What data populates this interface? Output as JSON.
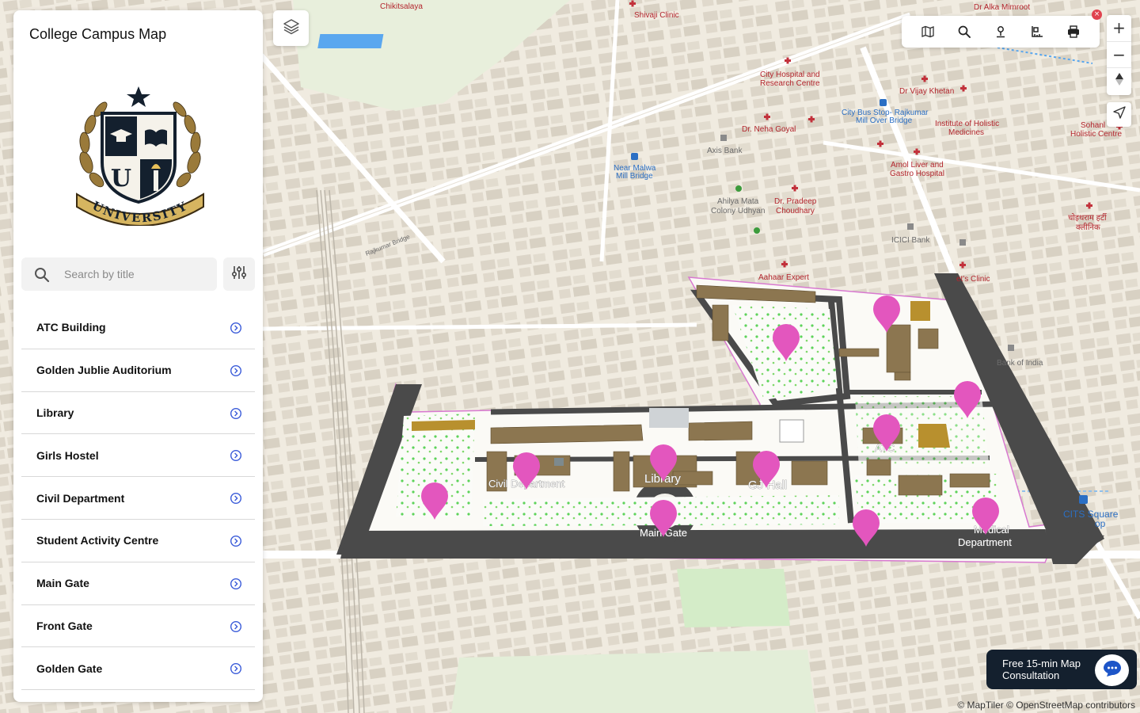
{
  "app": {
    "title": "College Campus Map"
  },
  "logo": {
    "letter": "U",
    "ribbon_text": "UNIVERSITY"
  },
  "search": {
    "placeholder": "Search by title",
    "value": ""
  },
  "locations": [
    {
      "label": "ATC Building"
    },
    {
      "label": "Golden Jublie Auditorium"
    },
    {
      "label": "Library"
    },
    {
      "label": "Girls Hostel"
    },
    {
      "label": "Civil Department"
    },
    {
      "label": "Student Activity Centre"
    },
    {
      "label": "Main Gate"
    },
    {
      "label": "Front Gate"
    },
    {
      "label": "Golden Gate"
    }
  ],
  "toolbar": {
    "icons": [
      "map-view-icon",
      "search-icon",
      "pin-icon",
      "ruler-icon",
      "print-icon"
    ]
  },
  "map_controls": {
    "zoom_in": "+",
    "zoom_out": "−",
    "close_badge": "×"
  },
  "map": {
    "places": [
      {
        "name": "Chikitsalaya"
      },
      {
        "name": "Shivaji Clinic"
      },
      {
        "name": "Dr Alka Mimroot"
      },
      {
        "name": "City Hospital and"
      },
      {
        "name": "Research Centre"
      },
      {
        "name": "Dr Vijay Khetan"
      },
      {
        "name": "City Bus Stop- Rajkumar"
      },
      {
        "name": "Mill Over Bridge"
      },
      {
        "name": "Institute of Holistic"
      },
      {
        "name": "Medicines"
      },
      {
        "name": "Sohanl"
      },
      {
        "name": "Holistic Centre"
      },
      {
        "name": "Dr. Neha Goyal"
      },
      {
        "name": "Axis Bank"
      },
      {
        "name": "Near Malwa"
      },
      {
        "name": "Mill Bridge"
      },
      {
        "name": "Amol Liver and"
      },
      {
        "name": "Gastro Hospital"
      },
      {
        "name": "Ahilya Mata"
      },
      {
        "name": "Colony Udhyan"
      },
      {
        "name": "Dr. Pradeep"
      },
      {
        "name": "Choudhary"
      },
      {
        "name": "ICICI Bank"
      },
      {
        "name": "चोइथराम हर्टी"
      },
      {
        "name": "क्लीनिक"
      },
      {
        "name": "Aahaar Expert"
      },
      {
        "name": "et's Clinic"
      },
      {
        "name": "Bank of India"
      },
      {
        "name": "CITS Square"
      },
      {
        "name": "op"
      },
      {
        "name": "Rajkumar Bridge"
      }
    ],
    "campus_labels": [
      {
        "name": "Civil Department"
      },
      {
        "name": "Library"
      },
      {
        "name": "GJ Hall"
      },
      {
        "name": "Main Gate"
      },
      {
        "name": "ATC"
      },
      {
        "name": "Department"
      },
      {
        "name": "Medical"
      },
      {
        "name": "Main Gate"
      }
    ]
  },
  "consultation": {
    "line1": "Free 15-min Map",
    "line2": "Consultation"
  },
  "attribution": "© MapTiler © OpenStreetMap contributors",
  "colors": {
    "marker": "#e356be",
    "brand_navy": "#14202e",
    "campus_road": "#4a4a4a",
    "map_bg": "#f0ebe0"
  }
}
